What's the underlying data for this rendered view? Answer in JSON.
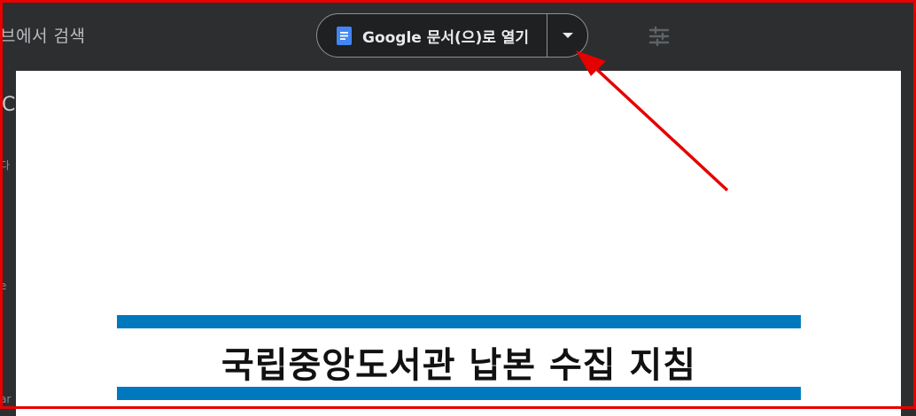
{
  "background": {
    "search_text": "브에서 검색",
    "side_text_1": "다",
    "side_text_2": "e",
    "side_text_3": "ar",
    "big_letter": "C"
  },
  "open_button": {
    "icon": "google-docs-icon",
    "label": "Google 문서(으)로 열기",
    "dropdown_icon": "caret-down-icon"
  },
  "document": {
    "title": "국립중앙도서관 납본 수집 지침"
  },
  "colors": {
    "annotation": "#e60000",
    "title_bars": "#0078bd",
    "docs_icon": "#4285f4",
    "dark_bg": "#2d2e2f"
  }
}
